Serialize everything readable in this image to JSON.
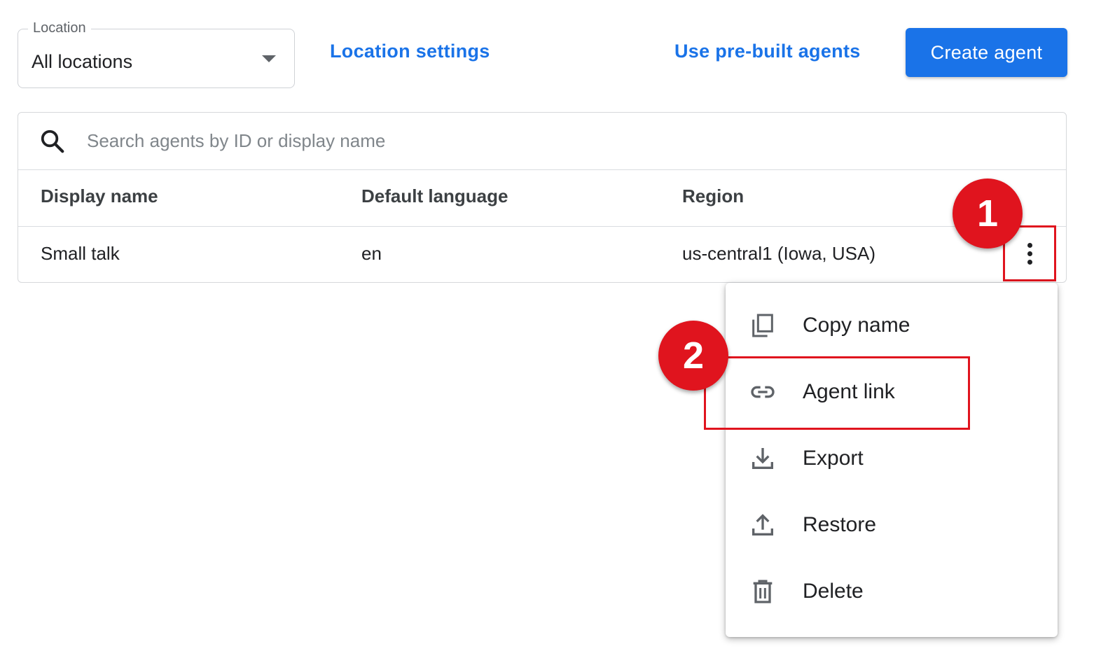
{
  "location_select": {
    "legend": "Location",
    "value": "All locations"
  },
  "toolbar": {
    "location_settings": "Location settings",
    "use_prebuilt": "Use pre-built agents",
    "create_agent": "Create agent"
  },
  "search": {
    "placeholder": "Search agents by ID or display name"
  },
  "table": {
    "headers": [
      "Display name",
      "Default language",
      "Region"
    ],
    "rows": [
      [
        "Small talk",
        "en",
        "us-central1 (Iowa, USA)"
      ]
    ]
  },
  "menu": {
    "items": [
      {
        "label": "Copy name",
        "icon": "copy-icon"
      },
      {
        "label": "Agent link",
        "icon": "link-icon"
      },
      {
        "label": "Export",
        "icon": "download-icon"
      },
      {
        "label": "Restore",
        "icon": "upload-icon"
      },
      {
        "label": "Delete",
        "icon": "trash-icon"
      }
    ]
  },
  "annotations": {
    "step1": "1",
    "step2": "2"
  },
  "colors": {
    "primary": "#1a73e8",
    "annotation_red": "#e0141e"
  }
}
